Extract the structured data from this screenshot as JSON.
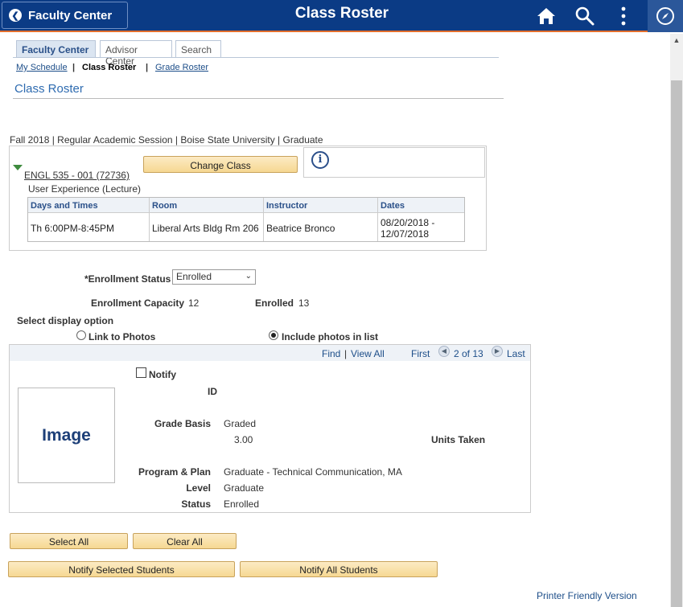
{
  "header": {
    "back_label": "Faculty Center",
    "title": "Class Roster",
    "icons": [
      "home-icon",
      "search-icon",
      "more-vertical-icon",
      "navbar-compass-icon"
    ],
    "accent_color": "#0b3b85",
    "border_color": "#e36f2c"
  },
  "tabs": [
    {
      "label": "Faculty Center",
      "active": true
    },
    {
      "label": "Advisor Center",
      "active": false
    },
    {
      "label": "Search",
      "active": false
    }
  ],
  "subnav": {
    "my_schedule": "My Schedule",
    "class_roster": "Class Roster",
    "grade_roster": "Grade Roster",
    "separator": "|"
  },
  "section_title": "Class Roster",
  "term_line": "Fall 2018 | Regular Academic Session | Boise State University | Graduate",
  "class_info": {
    "link": "ENGL 535 - 001 (72736)",
    "change_class_label": "Change Class",
    "description": "User Experience (Lecture)",
    "meeting_headers": [
      "Days and Times",
      "Room",
      "Instructor",
      "Dates"
    ],
    "meeting_row": {
      "days_times": "Th 6:00PM-8:45PM",
      "room": "Liberal Arts Bldg Rm 206",
      "instructor": "Beatrice Bronco",
      "dates": "08/20/2018 - 12/07/2018"
    }
  },
  "enrollment": {
    "status_label": "*Enrollment Status",
    "status_value": "Enrolled",
    "capacity_label": "Enrollment Capacity",
    "capacity_value": "12",
    "enrolled_label": "Enrolled",
    "enrolled_value": "13"
  },
  "display_option": {
    "label": "Select display option",
    "link_to_photos": "Link to Photos",
    "include_photos": "Include photos in list",
    "selected": "include_photos"
  },
  "student_nav": {
    "find": "Find",
    "sep": "|",
    "view_all": "View All",
    "first": "First",
    "position": "2 of 13",
    "last": "Last"
  },
  "student": {
    "notify_label": "Notify",
    "image_placeholder": "Image",
    "id_label": "ID",
    "grade_basis_label": "Grade Basis",
    "grade_basis_value": "Graded",
    "units_value": "3.00",
    "units_label": "Units Taken",
    "program_label": "Program & Plan",
    "program_value": "Graduate - Technical Communication, MA",
    "level_label": "Level",
    "level_value": "Graduate",
    "status_label": "Status",
    "status_value": "Enrolled"
  },
  "buttons": {
    "select_all": "Select All",
    "clear_all": "Clear All",
    "notify_selected": "Notify Selected Students",
    "notify_all": "Notify All Students"
  },
  "printer_link": "Printer Friendly Version"
}
